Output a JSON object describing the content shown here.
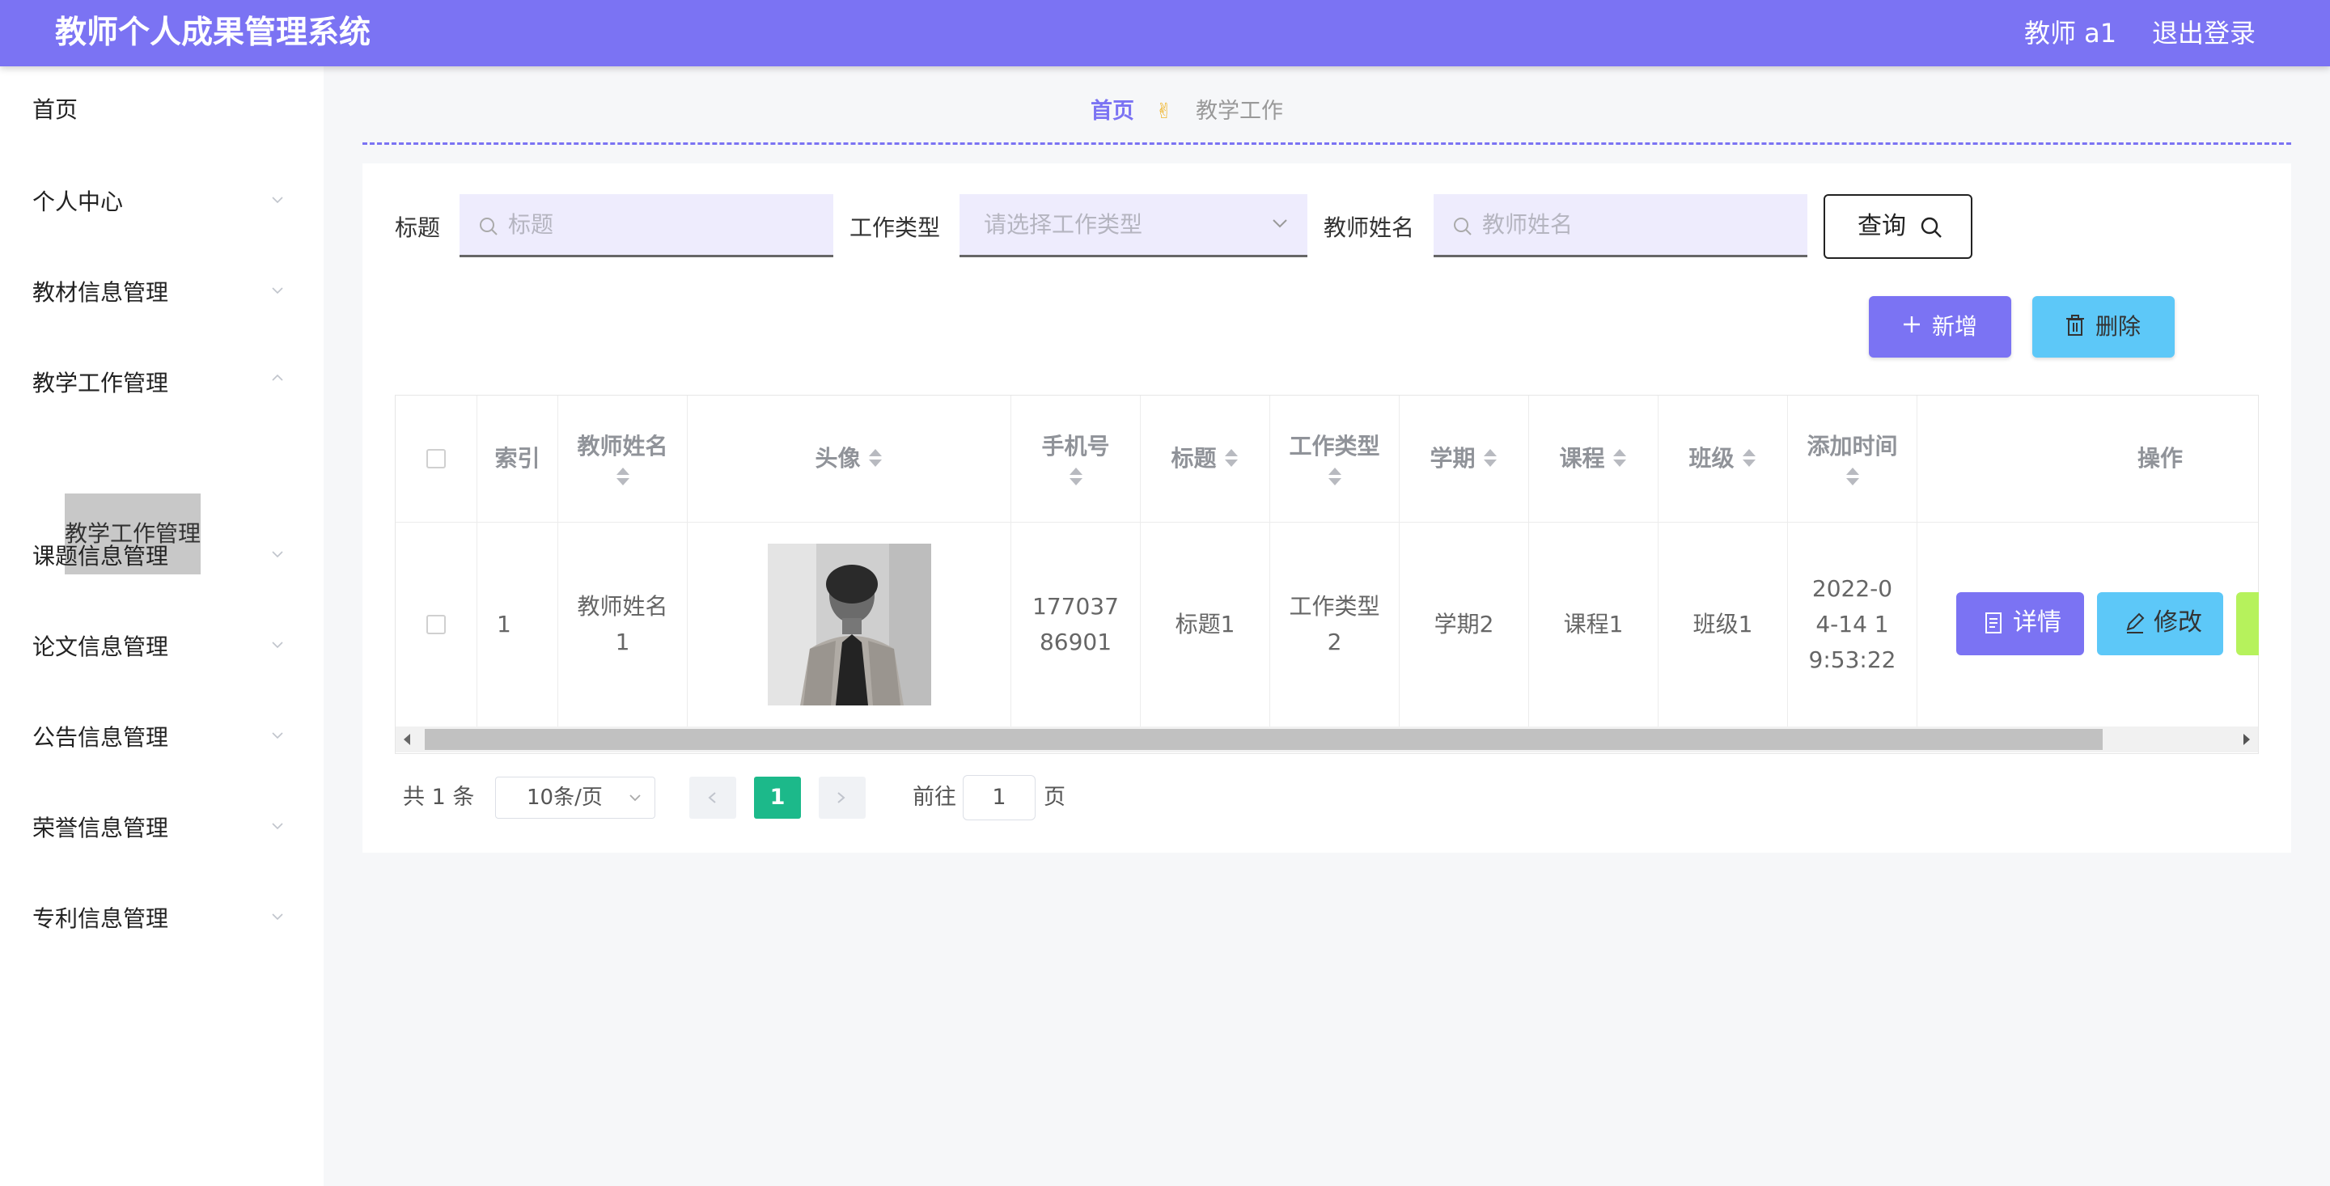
{
  "header": {
    "app_title": "教师个人成果管理系统",
    "user_label": "教师 a1",
    "logout_label": "退出登录"
  },
  "sidebar": {
    "items": [
      {
        "label": "首页"
      },
      {
        "label": "个人中心"
      },
      {
        "label": "教材信息管理"
      },
      {
        "label": "教学工作管理",
        "expanded": true
      },
      {
        "label": "课题信息管理"
      },
      {
        "label": "论文信息管理"
      },
      {
        "label": "公告信息管理"
      },
      {
        "label": "荣誉信息管理"
      },
      {
        "label": "专利信息管理"
      }
    ],
    "active_sub_item": "教学工作管理"
  },
  "breadcrumb": {
    "home": "首页",
    "separator_icon": "victory-hand-icon",
    "separator_glyph": "✌",
    "current": "教学工作"
  },
  "search": {
    "title_label": "标题",
    "title_placeholder": "标题",
    "type_label": "工作类型",
    "type_placeholder": "请选择工作类型",
    "teacher_label": "教师姓名",
    "teacher_placeholder": "教师姓名",
    "query_label": "查询"
  },
  "actions": {
    "add_label": "新增",
    "delete_label": "删除"
  },
  "table": {
    "columns": [
      "索引",
      "教师姓名",
      "头像",
      "手机号",
      "标题",
      "工作类型",
      "学期",
      "课程",
      "班级",
      "添加时间",
      "操作"
    ],
    "rows": [
      {
        "index": "1",
        "teacher": "教师姓名1",
        "phone": "17703786901",
        "title": "标题1",
        "work_type": "工作类型2",
        "semester": "学期2",
        "course": "课程1",
        "class": "班级1",
        "added": "2022-04-14 19:53:22"
      }
    ],
    "row_actions": {
      "detail_label": "详情",
      "edit_label": "修改"
    }
  },
  "pagination": {
    "total_text": "共 1 条",
    "page_size": "10条/页",
    "current_page": "1",
    "goto_label": "前往",
    "goto_value": "1",
    "page_suffix": "页"
  },
  "colors": {
    "primary": "#7b73f3",
    "info": "#5dc8f8",
    "success": "#1cb98a",
    "warning_green": "#b6f25c"
  }
}
